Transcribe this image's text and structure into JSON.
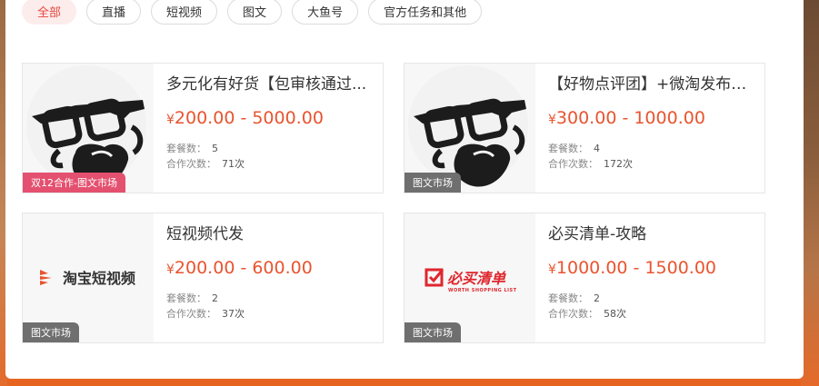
{
  "filters": {
    "tabs": [
      {
        "label": "全部",
        "active": true
      },
      {
        "label": "直播",
        "active": false
      },
      {
        "label": "短视频",
        "active": false
      },
      {
        "label": "图文",
        "active": false
      },
      {
        "label": "大鱼号",
        "active": false
      },
      {
        "label": "官方任务和其他",
        "active": false
      }
    ]
  },
  "cards": [
    {
      "title": "多元化有好货【包审核通过...",
      "currency": "¥",
      "price": "200.00 - 5000.00",
      "package_label": "套餐数：",
      "package_count": "5",
      "coop_label": "合作次数：",
      "coop_count": "71次",
      "badge": "双12合作-图文市场",
      "thumb_icon": "bearded-glasses-avatar-icon"
    },
    {
      "title": "【好物点评团】+微淘发布+2...",
      "currency": "¥",
      "price": "300.00 - 1000.00",
      "package_label": "套餐数：",
      "package_count": "4",
      "coop_label": "合作次数：",
      "coop_count": "172次",
      "badge": "图文市场",
      "thumb_icon": "bearded-glasses-avatar-icon"
    },
    {
      "title": "短视频代发",
      "currency": "¥",
      "price": "200.00 - 600.00",
      "package_label": "套餐数：",
      "package_count": "2",
      "coop_label": "合作次数：",
      "coop_count": "37次",
      "badge": "图文市场",
      "thumb_icon": "taobao-short-video-logo",
      "logo_text": "淘宝短视频"
    },
    {
      "title": "必买清单-攻略",
      "currency": "¥",
      "price": "1000.00 - 1500.00",
      "package_label": "套餐数：",
      "package_count": "2",
      "coop_label": "合作次数：",
      "coop_count": "58次",
      "badge": "图文市场",
      "thumb_icon": "must-buy-list-logo",
      "logo_text": "必买清单",
      "logo_subtext": "WORTH SHOPPING LIST"
    }
  ],
  "colors": {
    "price": "#e8542f",
    "active_tab_text": "#e5473f",
    "badge_pink": "#e4506f",
    "badge_gray": "#6f6f6f"
  }
}
